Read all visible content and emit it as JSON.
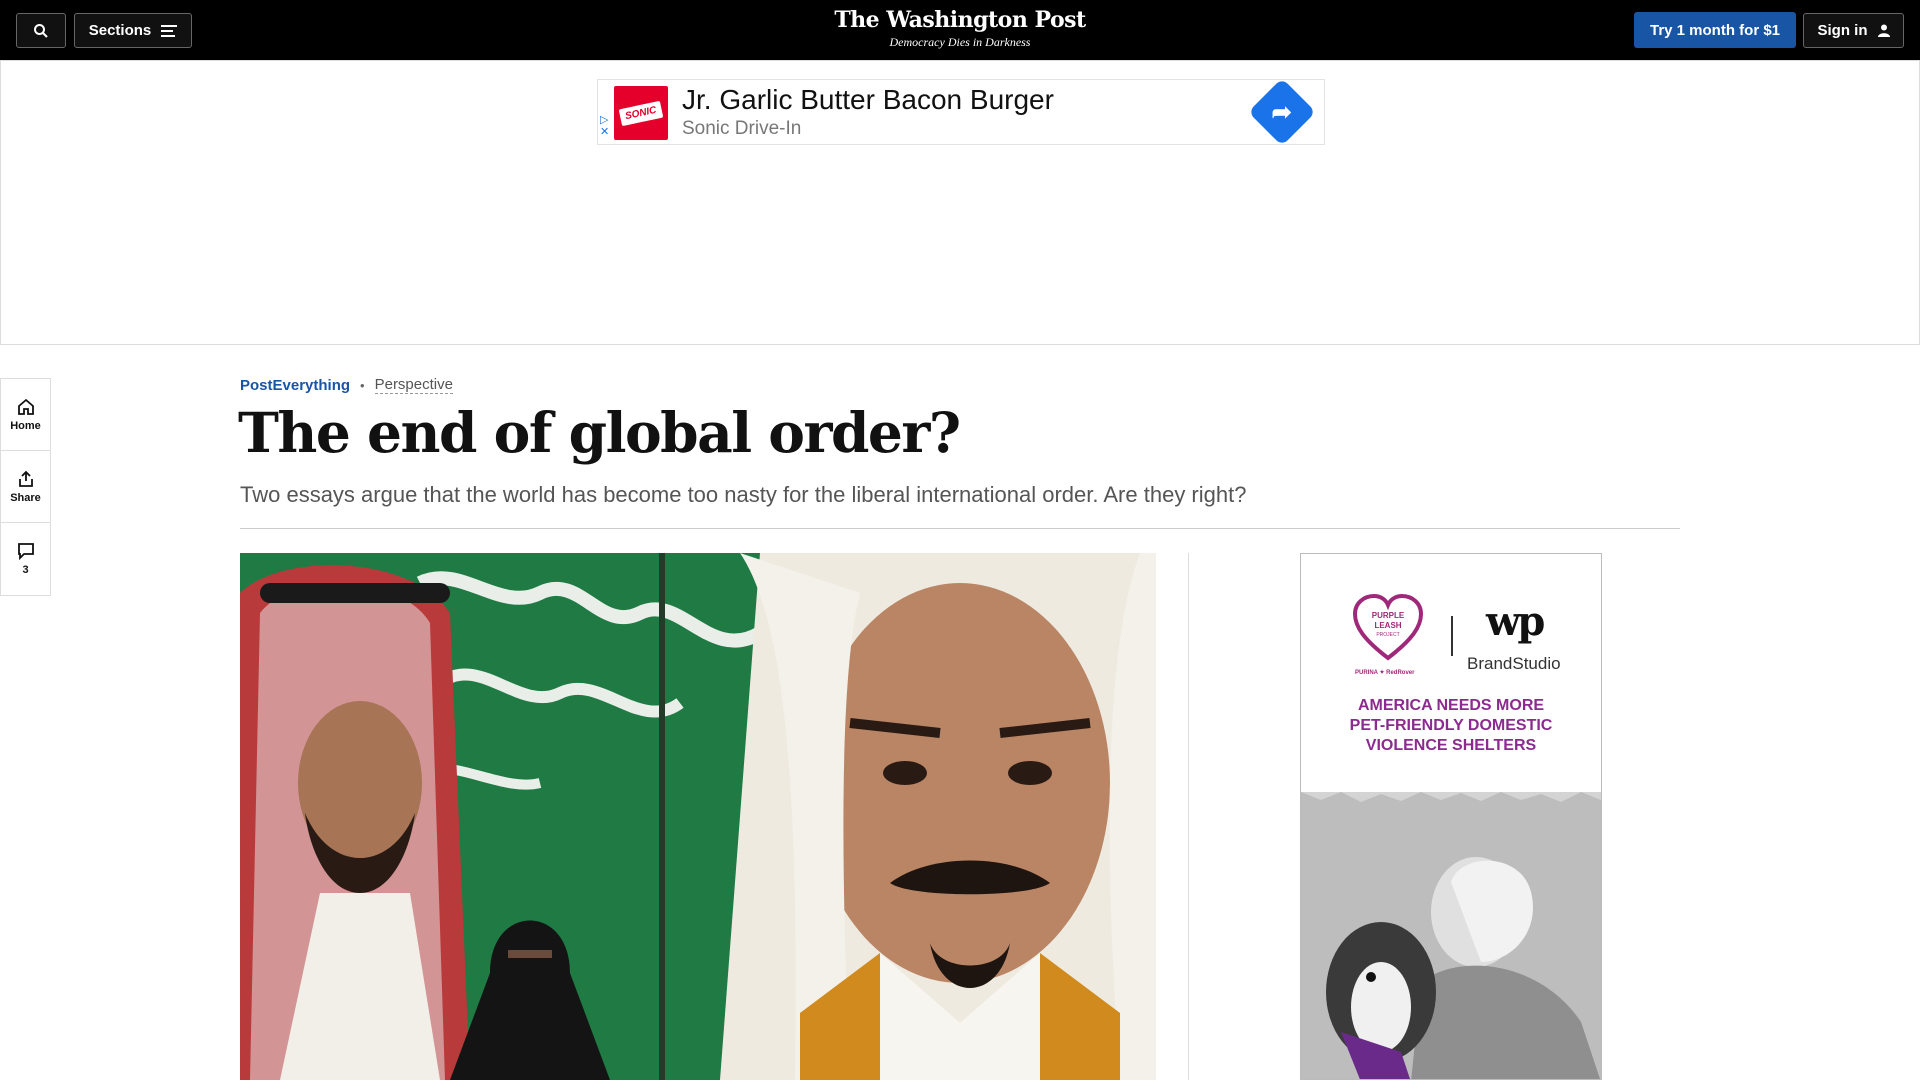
{
  "topbar": {
    "search_icon": "search-icon",
    "sections_label": "Sections",
    "menu_icon": "menu-icon",
    "logo": "The Washington Post",
    "tagline": "Democracy Dies in Darkness",
    "try_label": "Try 1 month for $1",
    "signin_label": "Sign in",
    "user_icon": "user-icon",
    "accent_color": "#1955a5"
  },
  "top_ad": {
    "title": "Jr. Garlic Butter Bacon Burger",
    "advertiser": "Sonic Drive-In",
    "logo_text": "SONIC",
    "arrow_icon": "directions-arrow-icon",
    "adchoices_icon": "adchoices-icon"
  },
  "left_rail": {
    "home_label": "Home",
    "share_label": "Share",
    "comments_count": "3"
  },
  "article": {
    "section": "PostEverything",
    "label": "Perspective",
    "headline": "The end of global order?",
    "dek": "Two essays argue that the world has become too nasty for the liberal international order. Are they right?"
  },
  "side_ad": {
    "brand_left": "PURPLE LEASH PROJECT",
    "wp_mark": "wp",
    "brand_right": "BrandStudio",
    "partners": "PURINA ✦ RedRover",
    "message_line1": "AMERICA NEEDS MORE",
    "message_line2": "PET-FRIENDLY DOMESTIC",
    "message_line3": "VIOLENCE SHELTERS"
  }
}
